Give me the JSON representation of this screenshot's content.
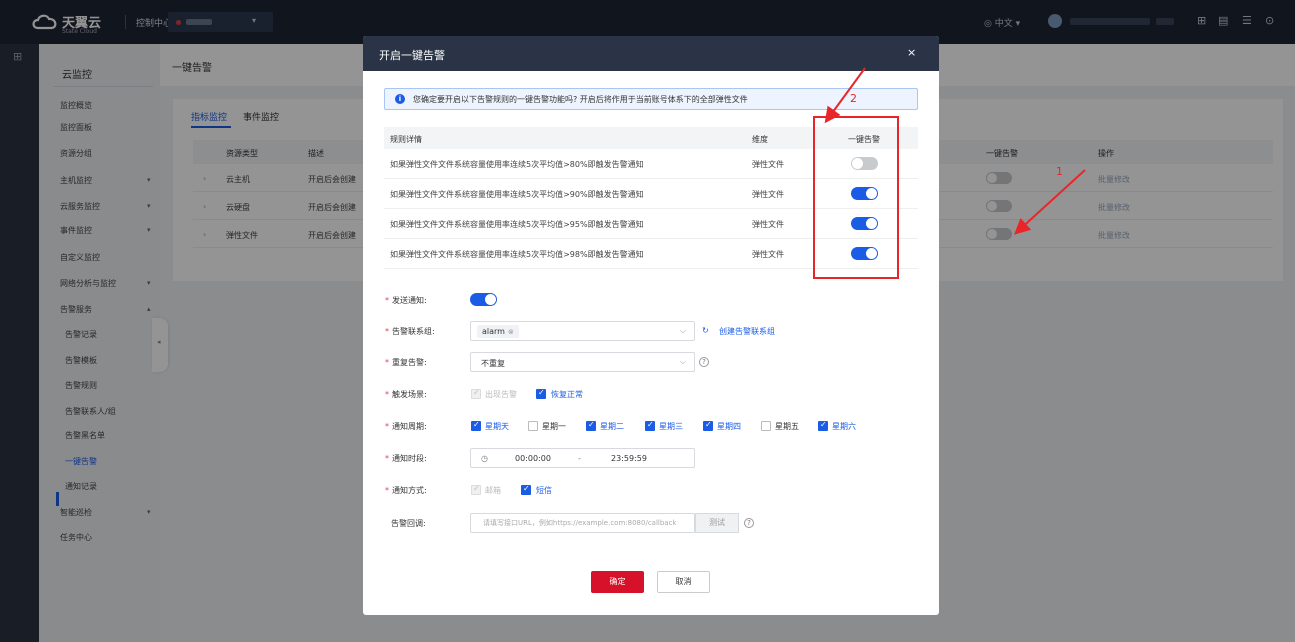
{
  "topbar": {
    "brand": "天翼云",
    "brand_sub": "State Cloud",
    "console": "控制中心",
    "lang": "中文 ▾",
    "icons": [
      "cart-icon",
      "ticket-icon",
      "list-icon",
      "help-icon"
    ]
  },
  "sidebar": {
    "title": "云监控",
    "items": [
      {
        "label": "监控概览",
        "arrow": ""
      },
      {
        "label": "监控面板",
        "arrow": ""
      },
      {
        "label": "资源分组",
        "arrow": ""
      },
      {
        "label": "主机监控",
        "arrow": "▾"
      },
      {
        "label": "云服务监控",
        "arrow": "▾"
      },
      {
        "label": "事件监控",
        "arrow": "▾"
      },
      {
        "label": "自定义监控",
        "arrow": ""
      },
      {
        "label": "网络分析与监控",
        "arrow": "▾"
      },
      {
        "label": "告警服务",
        "arrow": "▴"
      },
      {
        "label": "告警记录",
        "arrow": ""
      },
      {
        "label": "告警模板",
        "arrow": ""
      },
      {
        "label": "告警规则",
        "arrow": ""
      },
      {
        "label": "告警联系人/组",
        "arrow": ""
      },
      {
        "label": "告警黑名单",
        "arrow": ""
      },
      {
        "label": "一键告警",
        "arrow": ""
      },
      {
        "label": "通知记录",
        "arrow": ""
      },
      {
        "label": "智能巡检",
        "arrow": "▾"
      },
      {
        "label": "任务中心",
        "arrow": ""
      }
    ]
  },
  "page": {
    "title": "一键告警",
    "tabs": [
      "指标监控",
      "事件监控"
    ],
    "table_headers": [
      "资源类型",
      "描述",
      "一键告警",
      "操作"
    ],
    "rows": [
      {
        "type": "云主机",
        "desc": "开启后会创建",
        "action": "批量修改"
      },
      {
        "type": "云硬盘",
        "desc": "开启后会创建",
        "action": "批量修改"
      },
      {
        "type": "弹性文件",
        "desc": "开启后会创建",
        "action": "批量修改"
      }
    ]
  },
  "modal": {
    "title": "开启一键告警",
    "close": "×",
    "info": "您确定要开启以下告警规则的一键告警功能吗? 开启后将作用于当前账号体系下的全部弹性文件",
    "rule_headers": [
      "规则详情",
      "维度",
      "一键告警"
    ],
    "rules": [
      {
        "detail": "如果弹性文件文件系统容量使用率连续5次平均值>80%即触发告警通知",
        "dimension": "弹性文件",
        "enabled": false
      },
      {
        "detail": "如果弹性文件文件系统容量使用率连续5次平均值>90%即触发告警通知",
        "dimension": "弹性文件",
        "enabled": true
      },
      {
        "detail": "如果弹性文件文件系统容量使用率连续5次平均值>95%即触发告警通知",
        "dimension": "弹性文件",
        "enabled": true
      },
      {
        "detail": "如果弹性文件文件系统容量使用率连续5次平均值>98%即触发告警通知",
        "dimension": "弹性文件",
        "enabled": true
      }
    ],
    "form": {
      "send_notice_label": "发送通知:",
      "send_notice_on": true,
      "contact_group_label": "告警联系组:",
      "contact_group_value": "alarm",
      "create_group_link": "创建告警联系组",
      "repeat_label": "重复告警:",
      "repeat_value": "不重复",
      "trigger_label": "触发场景:",
      "trigger_options": [
        {
          "label": "出现告警",
          "checked": true,
          "disabled": true
        },
        {
          "label": "恢复正常",
          "checked": true,
          "disabled": false
        }
      ],
      "period_label": "通知周期:",
      "days": [
        {
          "label": "星期天",
          "checked": true
        },
        {
          "label": "星期一",
          "checked": false
        },
        {
          "label": "星期二",
          "checked": true
        },
        {
          "label": "星期三",
          "checked": true
        },
        {
          "label": "星期四",
          "checked": true
        },
        {
          "label": "星期五",
          "checked": false
        },
        {
          "label": "星期六",
          "checked": true
        }
      ],
      "time_label": "通知时段:",
      "time_start": "00:00:00",
      "time_sep": "-",
      "time_end": "23:59:59",
      "method_label": "通知方式:",
      "methods": [
        {
          "label": "邮箱",
          "checked": true,
          "disabled": true
        },
        {
          "label": "短信",
          "checked": true,
          "disabled": false
        }
      ],
      "callback_label": "告警回调:",
      "callback_placeholder": "请填写接口URL，例如https://example.com:8080/callback",
      "test_button": "测试"
    },
    "ok": "确定",
    "cancel": "取消"
  },
  "annotations": {
    "one": "1",
    "two": "2",
    "color": "#e8262a"
  },
  "colors": {
    "accent": "#1a5ce6",
    "primary_button": "#d8112a",
    "header_dark": "#1e2634"
  }
}
